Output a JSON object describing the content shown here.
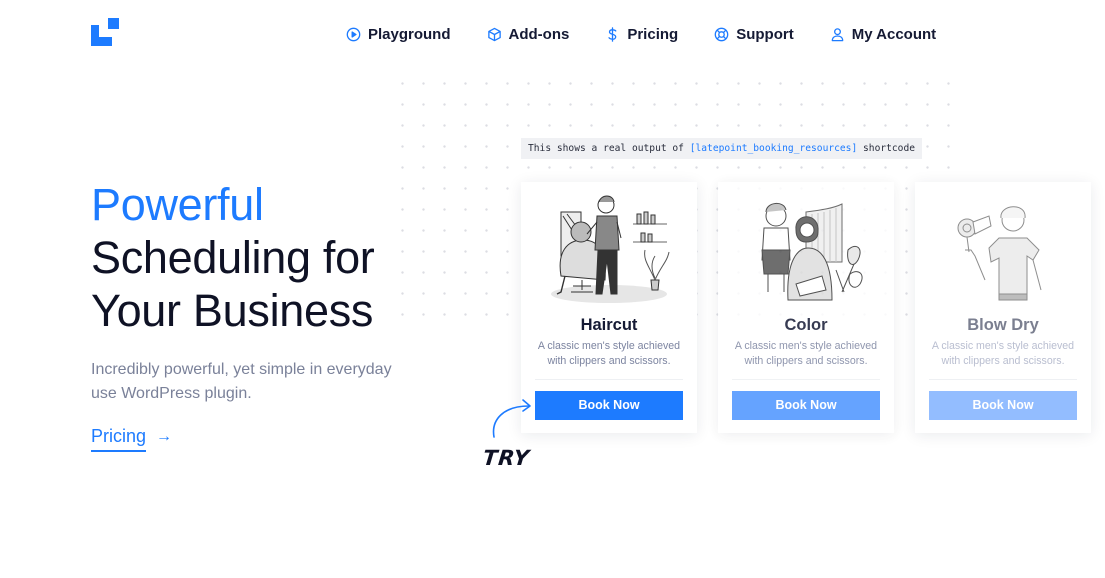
{
  "brand": {
    "logo": "latepoint-logo",
    "accent_color": "#1d7bff"
  },
  "nav": {
    "items": [
      {
        "label": "Playground",
        "icon": "play-circle-icon"
      },
      {
        "label": "Add-ons",
        "icon": "box-icon"
      },
      {
        "label": "Pricing",
        "icon": "dollar-icon"
      },
      {
        "label": "Support",
        "icon": "lifebuoy-icon"
      },
      {
        "label": "My Account",
        "icon": "user-icon"
      }
    ]
  },
  "hero": {
    "title_accent": "Powerful",
    "title_line2": "Scheduling for",
    "title_line3": "Your Business",
    "subtitle": "Incredibly powerful, yet simple in everyday use WordPress plugin.",
    "pricing_link": "Pricing",
    "pricing_arrow": "→"
  },
  "note": {
    "prefix": "This shows a real output of ",
    "code": "[latepoint_booking_resources]",
    "suffix": " shortcode"
  },
  "services": [
    {
      "title": "Haircut",
      "description": "A classic men's style achieved with clippers and scissors.",
      "button": "Book Now",
      "illustration": "barber-cutting-hair"
    },
    {
      "title": "Color",
      "description": "A classic men's style achieved with clippers and scissors.",
      "button": "Book Now",
      "illustration": "stylist-coloring-hair"
    },
    {
      "title": "Blow Dry",
      "description": "A classic men's style achieved with clippers and scissors.",
      "button": "Book Now",
      "illustration": "man-with-hair-dryer"
    }
  ],
  "try_label": "TRY"
}
